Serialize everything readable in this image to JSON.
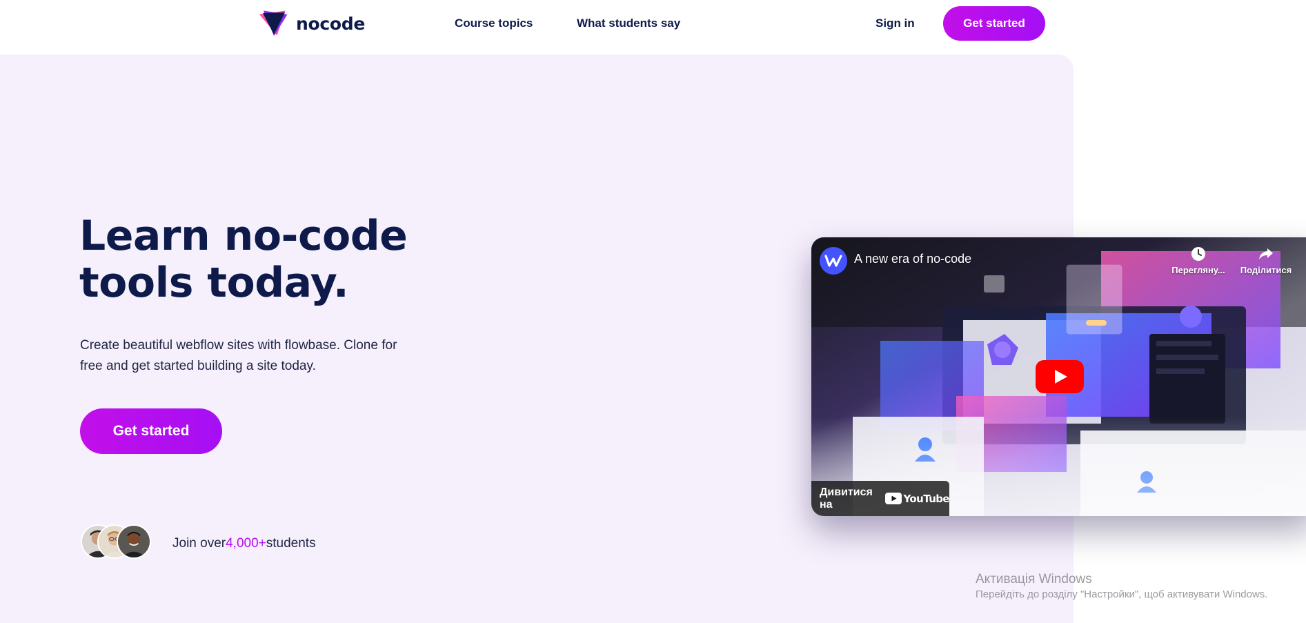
{
  "nav": {
    "brand": "nocode",
    "links": [
      "Course topics",
      "What students say"
    ],
    "sign_in": "Sign in",
    "cta": "Get started"
  },
  "hero": {
    "title_line1": "Learn no-code",
    "title_line2": "tools today.",
    "subtitle_line1": "Create beautiful webflow sites with flowbase. Clone for",
    "subtitle_line2": "free and get started building a site today.",
    "cta": "Get started",
    "join_prefix": "Join over",
    "join_count": "4,000+",
    "join_suffix": "students"
  },
  "video": {
    "channel_icon": "webflow-logo",
    "title": "A new era of no-code",
    "watch_later": "Перегляну...",
    "share": "Поділитися",
    "watch_on": "Дивитися на",
    "platform": "YouTube"
  },
  "watermark": {
    "title": "Активація Windows",
    "text": "Перейдіть до розділу \"Настройки\", щоб активувати Windows."
  },
  "colors": {
    "navy": "#0d1a4a",
    "accent": "#b40fee",
    "hero_bg": "#f6f0fd",
    "youtube_red": "#ff0000"
  }
}
